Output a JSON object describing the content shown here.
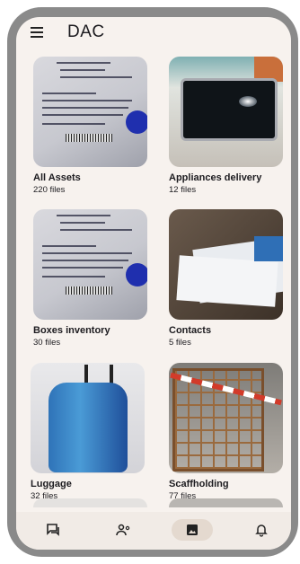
{
  "app": {
    "title": "DAC"
  },
  "albums": [
    {
      "name": "All Assets",
      "count": "220 files"
    },
    {
      "name": "Appliances delivery",
      "count": "12 files"
    },
    {
      "name": "Boxes inventory",
      "count": "30 files"
    },
    {
      "name": "Contacts",
      "count": "5 files"
    },
    {
      "name": "Luggage",
      "count": "32 files"
    },
    {
      "name": "Scaffholding",
      "count": "77 files"
    }
  ],
  "bottom_nav": {
    "items": [
      "chat-icon",
      "people-settings-icon",
      "gallery-icon",
      "bell-icon"
    ],
    "active": "gallery-icon"
  },
  "colors": {
    "background": "#f7f2ee",
    "bottom_bar": "#f1ebe6",
    "active_pill": "#e4d9cf",
    "frame": "#8a8a8a"
  }
}
